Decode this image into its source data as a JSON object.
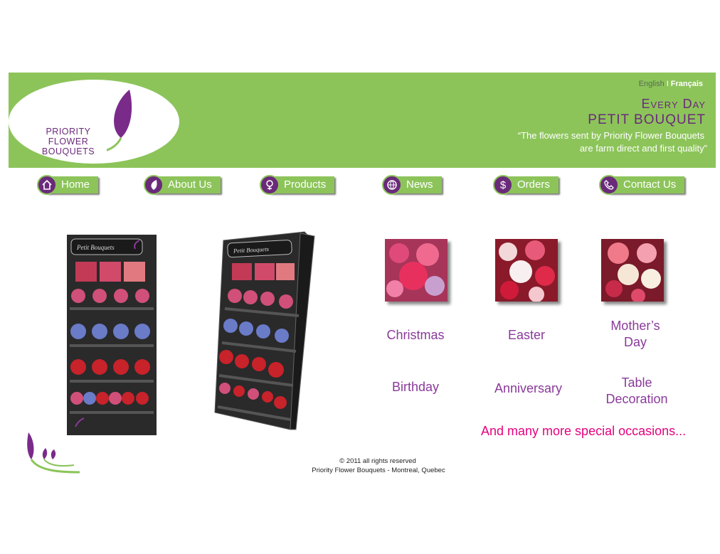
{
  "header": {
    "logo_line1": "PRIORITY FLOWER",
    "logo_line2": "BOUQUETS",
    "lang_en": "English",
    "lang_sep": "I",
    "lang_fr": "Français",
    "tagline1": "Every Day",
    "tagline2": "PETIT BOUQUET",
    "quote1": "“The flowers sent by Priority Flower Bouquets",
    "quote2": "are farm direct and first quality”"
  },
  "nav": [
    {
      "label": "Home",
      "icon": "home-icon"
    },
    {
      "label": "About Us",
      "icon": "leaf-icon"
    },
    {
      "label": "Products",
      "icon": "flower-icon"
    },
    {
      "label": "News",
      "icon": "globe-icon"
    },
    {
      "label": "Orders",
      "icon": "dollar-icon",
      "glyph": "$"
    },
    {
      "label": "Contact Us",
      "icon": "phone-icon"
    }
  ],
  "displays": {
    "sign_text": "Petit Bouquets"
  },
  "occasions": [
    "Christmas",
    "Easter",
    "Mother’s Day",
    "Birthday",
    "Anniversary",
    "Table Decoration"
  ],
  "more_text": "And many more special occasions...",
  "footer": {
    "copyright": "© 2011 all rights reserved",
    "company": "Priority Flower Bouquets - Montreal, Quebec"
  },
  "colors": {
    "brand_green": "#8cc45a",
    "brand_purple": "#6a2a7a",
    "occasion_text": "#8a3a9a",
    "accent_pink": "#e5007e"
  }
}
